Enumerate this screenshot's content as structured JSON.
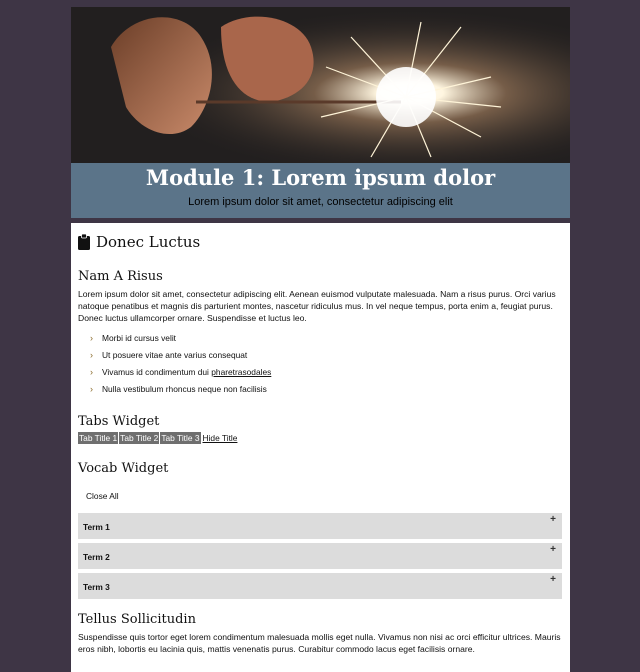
{
  "hero": {
    "title": "Module 1: Lorem ipsum dolor",
    "subtitle": "Lorem ipsum dolor sit amet, consectetur adipiscing elit"
  },
  "section": {
    "icon": "clipboard-icon",
    "title": "Donec Luctus"
  },
  "nam": {
    "heading": "Nam A Risus",
    "paragraph": "Lorem ipsum dolor sit amet, consectetur adipiscing elit. Aenean euismod vulputate malesuada. Nam a risus purus. Orci varius natoque penatibus et magnis dis parturient montes, nascetur ridiculus mus. In vel neque tempus, porta enim a, feugiat purus. Donec luctus ullamcorper ornare. Suspendisse et luctus leo.",
    "bullets": [
      {
        "text": "Morbi id cursus velit"
      },
      {
        "text": "Ut posuere vitae ante varius consequat"
      },
      {
        "prefix": "Vivamus id condimentum dui ",
        "link": "pharetrasodales"
      },
      {
        "text": "Nulla vestibulum rhoncus neque non facilisis"
      }
    ]
  },
  "tabs_widget": {
    "heading": "Tabs Widget",
    "tabs": [
      "Tab Title 1",
      "Tab Title 2",
      "Tab Title 3"
    ],
    "hide_label": "Hide Title"
  },
  "vocab": {
    "heading": "Vocab Widget",
    "close_all": "Close All",
    "terms": [
      "Term 1",
      "Term 2",
      "Term 3"
    ],
    "expand_symbol": "+"
  },
  "tellus": {
    "heading": "Tellus Sollicitudin",
    "paragraph": "Suspendisse quis tortor eget lorem condimentum malesuada mollis eget nulla. Vivamus non nisi ac orci efficitur ultrices. Mauris eros nibh, lobortis eu lacinia quis, mattis venenatis purus. Curabitur commodo lacus eget facilisis ornare."
  },
  "colors": {
    "banner": "#5b7489",
    "background": "#3e3545",
    "tab": "#6f6f6f",
    "accordion": "#dcdcdc"
  }
}
